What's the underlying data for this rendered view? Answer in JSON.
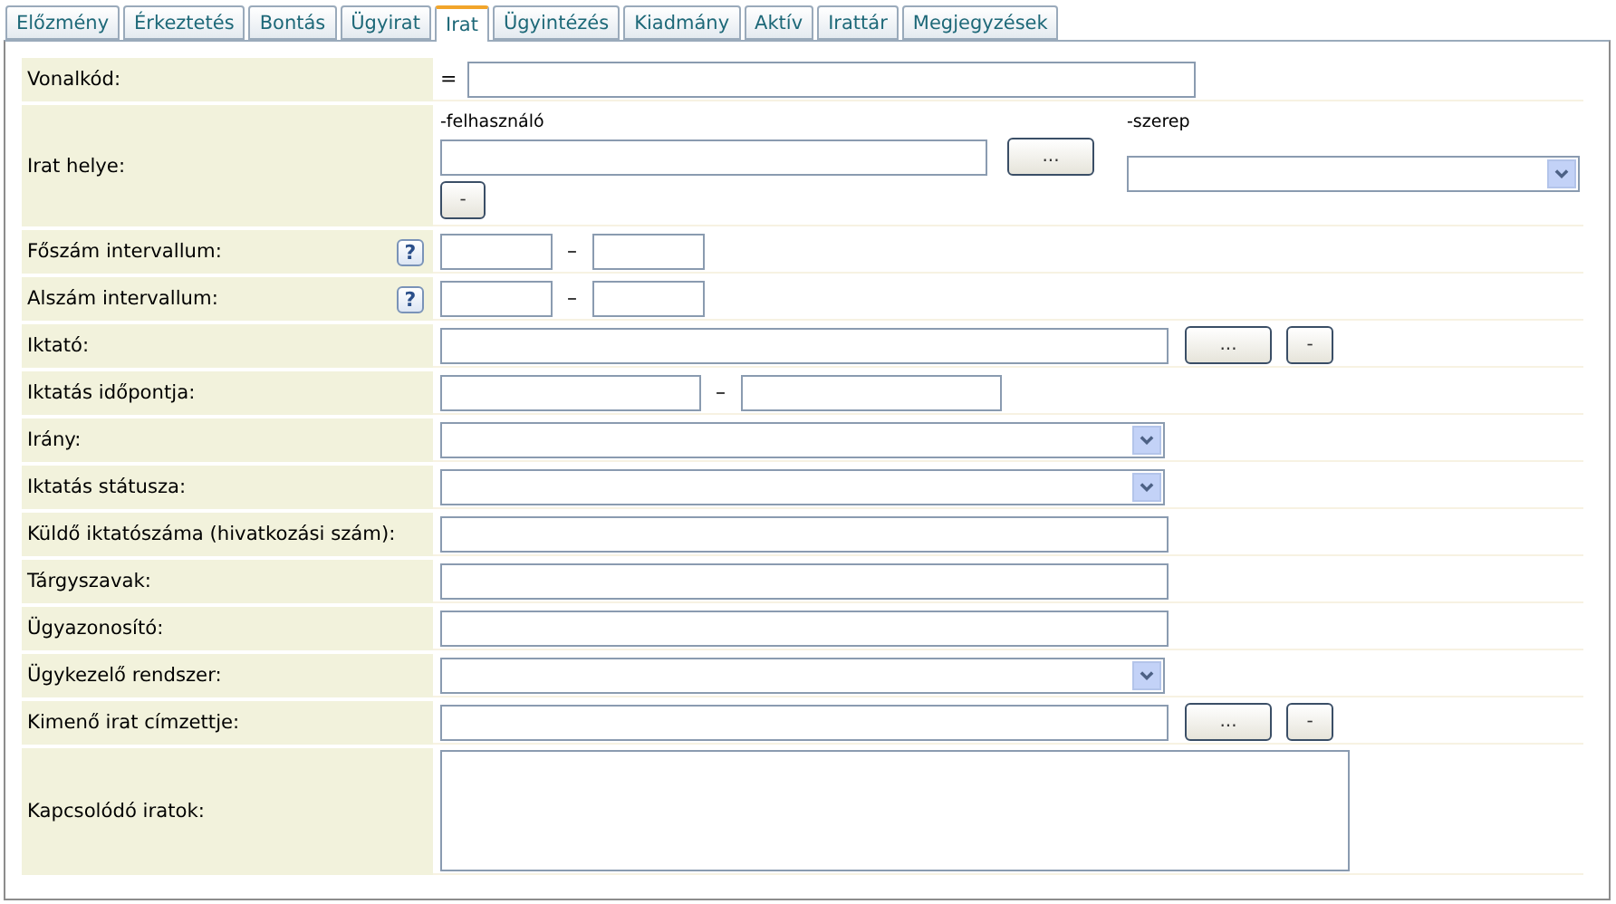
{
  "tabs": [
    {
      "label": "Előzmény",
      "selected": false
    },
    {
      "label": "Érkeztetés",
      "selected": false
    },
    {
      "label": "Bontás",
      "selected": false
    },
    {
      "label": "Ügyirat",
      "selected": false
    },
    {
      "label": "Irat",
      "selected": true
    },
    {
      "label": "Ügyintézés",
      "selected": false
    },
    {
      "label": "Kiadmány",
      "selected": false
    },
    {
      "label": "Aktív",
      "selected": false
    },
    {
      "label": "Irattár",
      "selected": false
    },
    {
      "label": "Megjegyzések",
      "selected": false
    }
  ],
  "fields": [
    {
      "kind": "barcode",
      "label": "Vonalkód:",
      "operator": "="
    },
    {
      "kind": "location",
      "label": "Irat helye:",
      "user_label": "-felhasználó",
      "browse_button": "...",
      "clear_button": "-",
      "role_label": "-szerep"
    },
    {
      "kind": "interval",
      "label": "Főszám intervallum:",
      "help": "?",
      "separator": "–"
    },
    {
      "kind": "interval",
      "label": "Alszám intervallum:",
      "help": "?",
      "separator": "–"
    },
    {
      "kind": "picker",
      "label": "Iktató:",
      "browse_button": "...",
      "clear_button": "-"
    },
    {
      "kind": "daterange",
      "label": "Iktatás időpontja:",
      "separator": "–"
    },
    {
      "kind": "select",
      "label": "Irány:"
    },
    {
      "kind": "select",
      "label": "Iktatás státusza:"
    },
    {
      "kind": "text",
      "label": "Küldő iktatószáma (hivatkozási szám):"
    },
    {
      "kind": "text",
      "label": "Tárgyszavak:"
    },
    {
      "kind": "text",
      "label": "Ügyazonosító:"
    },
    {
      "kind": "select",
      "label": "Ügykezelő rendszer:"
    },
    {
      "kind": "picker",
      "label": "Kimenő irat címzettje:",
      "browse_button": "...",
      "clear_button": "-"
    },
    {
      "kind": "textarea",
      "label": "Kapcsolódó iratok:"
    }
  ]
}
